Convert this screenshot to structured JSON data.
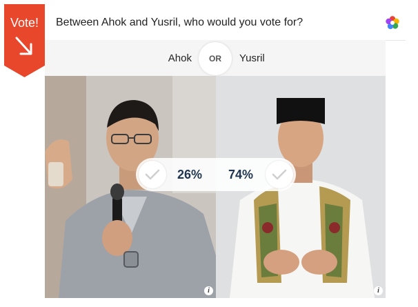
{
  "ribbon": {
    "label": "Vote!"
  },
  "poll": {
    "question": "Between Ahok and Yusril, who would you vote for?"
  },
  "options": {
    "left_name": "Ahok",
    "separator": "OR",
    "right_name": "Yusril"
  },
  "results": {
    "left_percent": "26%",
    "right_percent": "74%"
  },
  "info_glyph": "i",
  "colors": {
    "ribbon": "#e8472b",
    "percent_text": "#1f3550"
  },
  "icons": [
    "arrow-down-right-icon",
    "colorful-flower-logo",
    "check-icon",
    "info-icon"
  ]
}
